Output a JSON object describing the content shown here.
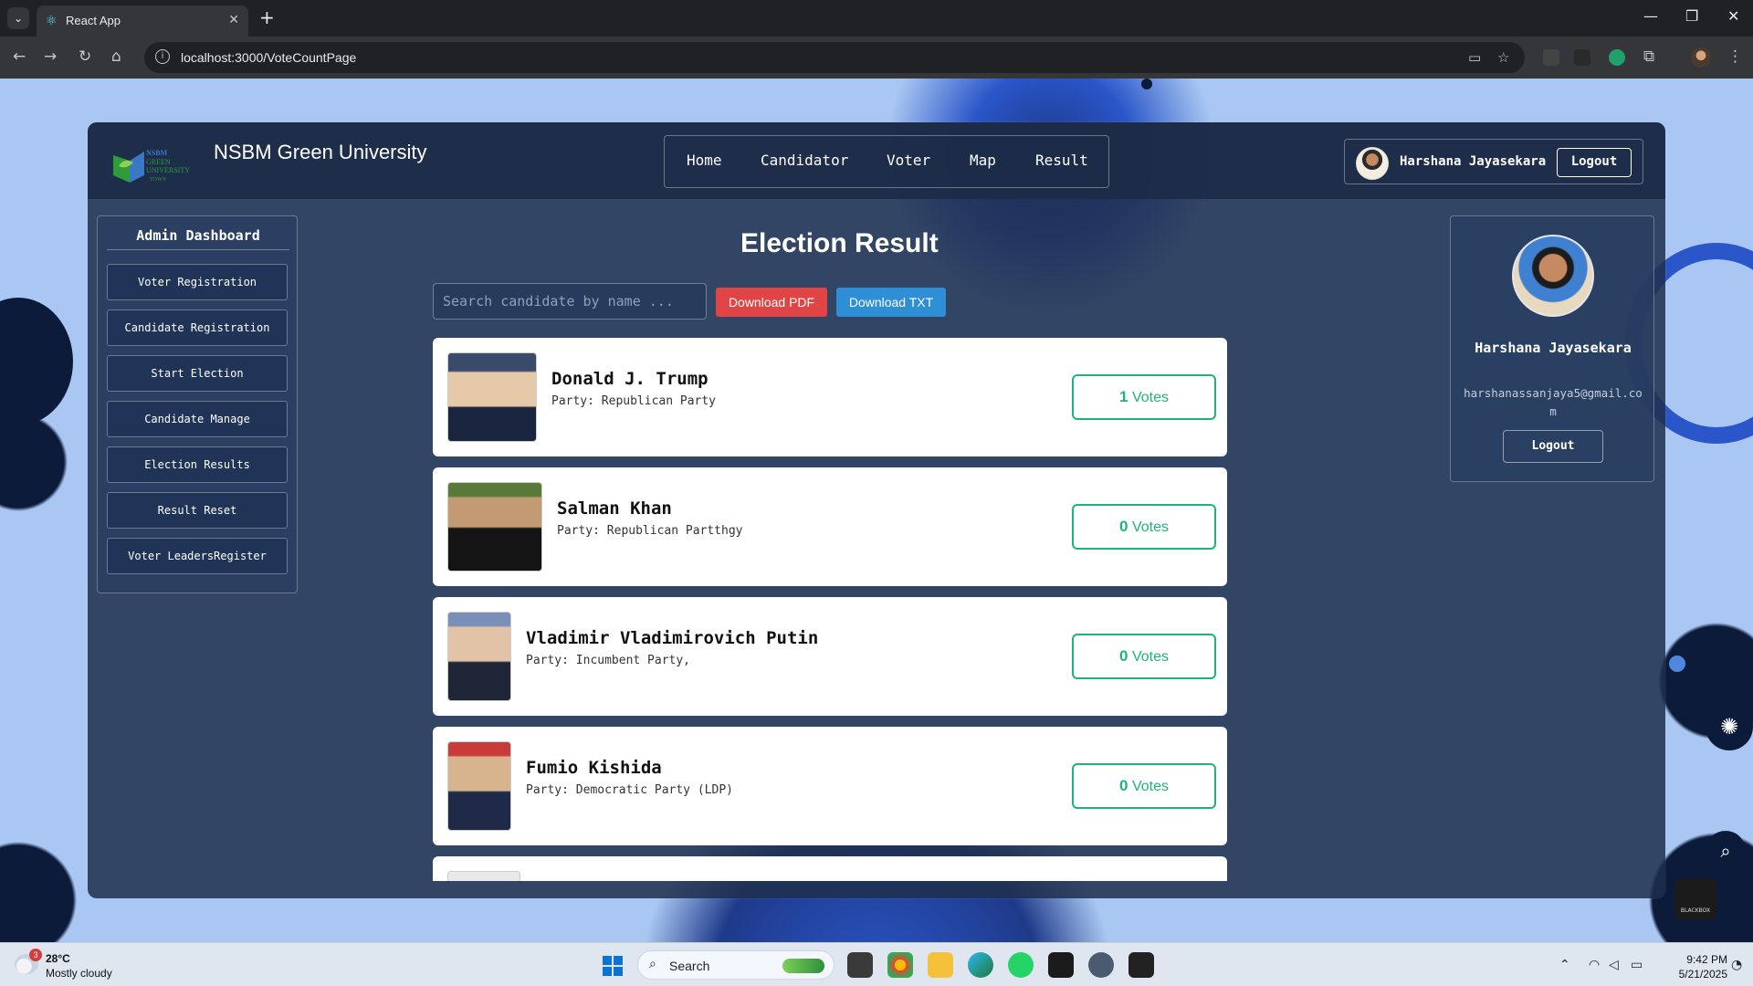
{
  "browser": {
    "tab_title": "React App",
    "url": "localhost:3000/VoteCountPage",
    "icons": {
      "tab_favicon": "react-icon",
      "close_tab": "close-icon",
      "new_tab": "plus-icon",
      "back": "arrow-left-icon",
      "forward": "arrow-right-icon",
      "reload": "reload-icon",
      "home": "home-icon",
      "site_info": "info-icon",
      "bookmark": "star-icon",
      "menu": "kebab-menu-icon"
    }
  },
  "header": {
    "brand": "NSBM Green University",
    "nav": [
      "Home",
      "Candidator",
      "Voter",
      "Map",
      "Result"
    ],
    "user_name": "Harshana Jayasekara",
    "logout_label": "Logout"
  },
  "sidebar": {
    "title": "Admin Dashboard",
    "items": [
      "Voter Registration",
      "Candidate Registration",
      "Start Election",
      "Candidate Manage",
      "Election Results",
      "Result Reset",
      "Voter LeadersRegister"
    ]
  },
  "main": {
    "title": "Election Result",
    "search_placeholder": "Search candidate by name ...",
    "download_pdf": "Download PDF",
    "download_txt": "Download TXT",
    "candidates": [
      {
        "name": "Donald J. Trump",
        "party": "Party: Republican Party",
        "votes": "1",
        "votes_label": "Votes"
      },
      {
        "name": "Salman Khan",
        "party": "Party: Republican Partthgy",
        "votes": "0",
        "votes_label": "Votes"
      },
      {
        "name": "Vladimir Vladimirovich Putin",
        "party": "Party: Incumbent Party,",
        "votes": "0",
        "votes_label": "Votes"
      },
      {
        "name": "Fumio Kishida",
        "party": "Party: Democratic Party (LDP)",
        "votes": "0",
        "votes_label": "Votes"
      }
    ]
  },
  "profile": {
    "name": "Harshana Jayasekara",
    "email": "harshanassanjaya5@gmail.com",
    "logout_label": "Logout"
  },
  "taskbar": {
    "temperature": "28°C",
    "condition": "Mostly cloudy",
    "weather_badge": "3",
    "search_label": "Search",
    "time": "9:42 PM",
    "date": "5/21/2025"
  },
  "colors": {
    "accent_green": "#1fb27a",
    "pdf_red": "#e04444",
    "txt_blue": "#2f8fd6",
    "panel": "#1e304e"
  }
}
